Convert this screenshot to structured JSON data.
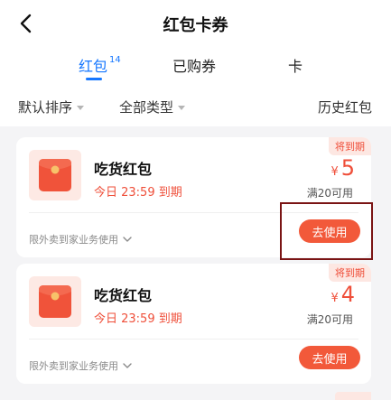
{
  "header": {
    "title": "红包卡券",
    "back_icon": "chevron-left-icon"
  },
  "tabs": [
    {
      "label": "红包",
      "count": "14",
      "active": true
    },
    {
      "label": "已购券",
      "active": false
    },
    {
      "label": "卡",
      "active": false
    }
  ],
  "filters": {
    "sort": "默认排序",
    "type": "全部类型",
    "history": "历史红包"
  },
  "coupons": [
    {
      "tag": "将到期",
      "name": "吃货红包",
      "expiry": "今日 23:59 到期",
      "currency": "¥",
      "amount": "5",
      "condition": "满20可用",
      "scope": "限外卖到家业务使用",
      "button": "去使用"
    },
    {
      "tag": "将到期",
      "name": "吃货红包",
      "expiry": "今日 23:59 到期",
      "currency": "¥",
      "amount": "4",
      "condition": "满20可用",
      "scope": "限外卖到家业务使用",
      "button": "去使用"
    }
  ],
  "colors": {
    "accent_blue": "#1677ff",
    "coupon_red": "#ef4f3a",
    "button_red": "#f2593a",
    "highlight": "#7a1414"
  }
}
